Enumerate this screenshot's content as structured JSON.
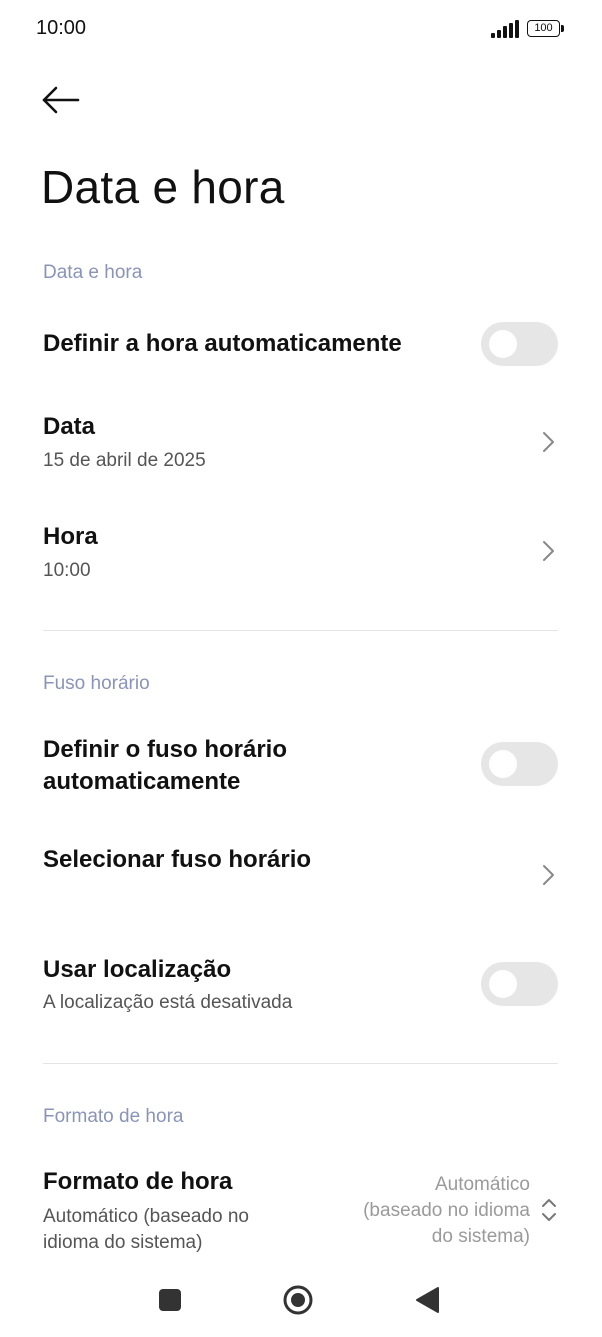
{
  "status_bar": {
    "time": "10:00",
    "battery": "100",
    "icons": [
      "signal-icon",
      "battery-icon"
    ]
  },
  "header": {
    "back_icon": "arrow-left-icon",
    "title": "Data e hora"
  },
  "sections": {
    "date_time": {
      "label": "Data e hora",
      "auto_time": {
        "label": "Definir a hora automaticamente",
        "enabled": false
      },
      "date": {
        "label": "Data",
        "value": "15 de abril de 2025"
      },
      "time": {
        "label": "Hora",
        "value": "10:00"
      }
    },
    "timezone": {
      "label": "Fuso horário",
      "auto_tz": {
        "line1": "Definir o fuso horário",
        "line2": "automaticamente",
        "enabled": false
      },
      "select_tz": {
        "label": "Selecionar fuso horário"
      },
      "use_location": {
        "label": "Usar localização",
        "sub": "A localização está desativada",
        "enabled": false
      }
    },
    "format": {
      "label": "Formato de hora",
      "row": {
        "label": "Formato de hora",
        "sub1": "Automático (baseado no",
        "sub2": "idioma do sistema)",
        "value1": "Automático",
        "value2": "(baseado no idioma",
        "value3": "do sistema)"
      }
    }
  },
  "nav_bar": {
    "icons": [
      "recents-square-icon",
      "home-circle-icon",
      "back-triangle-icon"
    ]
  },
  "colors": {
    "section_label": "#8a94b8",
    "toggle_off": "#e6e6e6",
    "text_primary": "#111111",
    "text_secondary": "#555555"
  }
}
